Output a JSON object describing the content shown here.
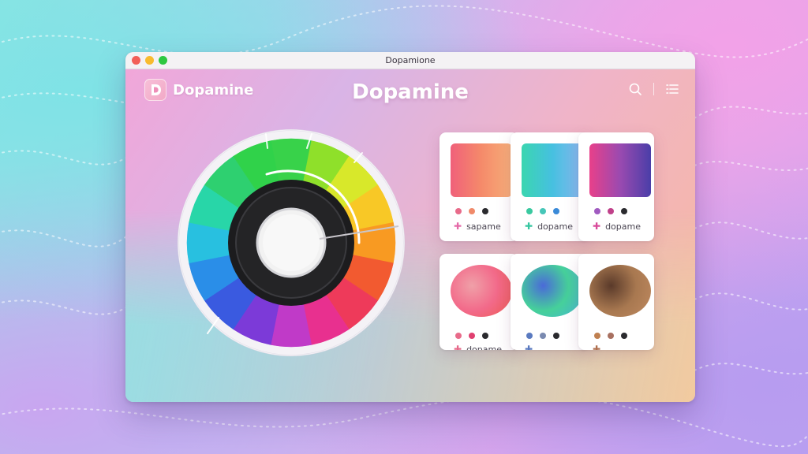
{
  "window": {
    "title": "Dopamione"
  },
  "header": {
    "brand_name": "Dopamine",
    "title": "Dopamine",
    "icons": [
      "search-icon",
      "list-menu-icon"
    ]
  },
  "colors": {
    "accent": "#f2a6d8",
    "brand": "#ee8fb8",
    "knob_dark": "#1c1c1e",
    "knob_light": "#f2f2f2"
  },
  "color_wheel": {
    "segments": [
      "#38d24a",
      "#8fe02a",
      "#d8e82a",
      "#f8c826",
      "#f89a22",
      "#f25a30",
      "#ee3a5a",
      "#e8308f",
      "#c03ac8",
      "#7c3ad8",
      "#3a5ae0",
      "#2a8ee8",
      "#28c0e0",
      "#28d6a8",
      "#2ed070",
      "#30d24a"
    ]
  },
  "palettes_top": [
    {
      "label": "sapame",
      "colors": [
        "#f0607a",
        "#f58a6a",
        "#f7b07a"
      ],
      "dots": [
        "#e86b8a",
        "#f08a6a",
        "#2a2a2e"
      ],
      "plus_color": "#e46aa8"
    },
    {
      "label": "dopame",
      "colors": [
        "#3ad6b0",
        "#46c0e0",
        "#8ab8f0"
      ],
      "dots": [
        "#3ac9a0",
        "#46c6b8",
        "#3a8ad8"
      ],
      "plus_color": "#36c6a0"
    },
    {
      "label": "dopame",
      "colors": [
        "#e8408a",
        "#9a4ab0",
        "#4a3ea8"
      ],
      "dots": [
        "#a05ac0",
        "#c0408a",
        "#2a2a2e"
      ],
      "plus_color": "#d84a9a"
    }
  ],
  "palettes_bottom": [
    {
      "label": "dopame",
      "colors": [
        "#f26a8a",
        "#ee5a50",
        "#f0a0a8"
      ],
      "dots": [
        "#e86b8a",
        "#e04070",
        "#2a2a2e"
      ],
      "plus_color": "#e66a8a"
    },
    {
      "label": "",
      "colors": [
        "#46d09a",
        "#46b8d8",
        "#4a6ad8"
      ],
      "dots": [
        "#5a7ac0",
        "#7a8ab0",
        "#2a2a2e"
      ],
      "plus_color": "#5a7ac0"
    },
    {
      "label": "",
      "colors": [
        "#a87850",
        "#c08a60",
        "#5a3a2a"
      ],
      "dots": [
        "#c08050",
        "#a87060",
        "#2a2a2e"
      ],
      "plus_color": "#b07050"
    }
  ]
}
